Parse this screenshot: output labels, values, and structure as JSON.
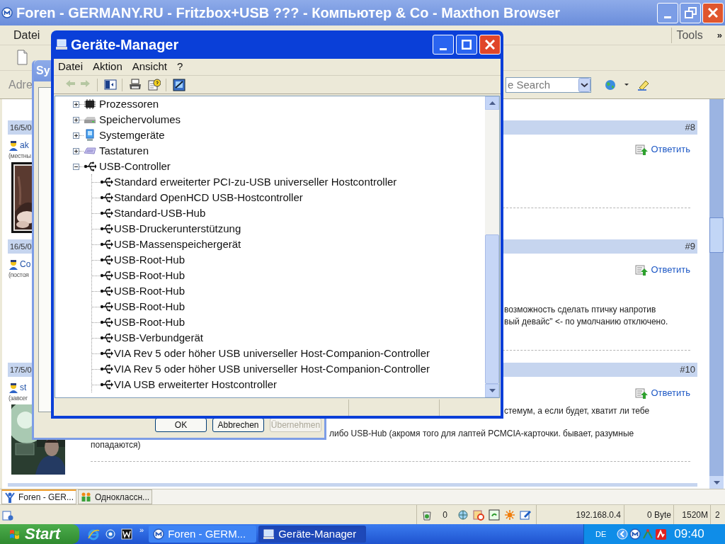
{
  "browser": {
    "title": "Foren - GERMANY.RU - Fritzbox+USB ??? - Компьютер & Co - Maxthon Browser",
    "menu": [
      "Datei",
      "Tools",
      "»"
    ],
    "address_label": "Adre",
    "search": {
      "value": "e Search"
    },
    "posts": [
      {
        "date": "16/5/0",
        "number": "#8",
        "user": "ak",
        "role": "(местны",
        "reply": "Ответить",
        "avatar": {
          "kind": "picture"
        }
      },
      {
        "date": "16/5/0",
        "number": "#9",
        "user": "Co",
        "role": "(постоя",
        "reply": "Ответить",
        "lines": [
          "возможность сделать птичку напротив",
          "вый девайс\" <- по умолчанию отключено."
        ]
      },
      {
        "date": "17/5/0",
        "number": "#10",
        "user": "st",
        "role": "(завсег",
        "reply": "Ответить",
        "avatar": {
          "kind": "picture"
        },
        "lines": [
          "стемум, а если будет, хватит ли тебе"
        ],
        "continuation": [
          "либо USB-Hub (акромя того для лаптей PCMCIA-карточки. бывает, разумные",
          "попадаются)"
        ]
      }
    ],
    "tabs": [
      {
        "label": "Foren - GER...",
        "selected": true
      },
      {
        "label": "Одноклассн...",
        "selected": false
      }
    ],
    "status_bar": {
      "counter": "0",
      "ip": "192.168.0.4",
      "traffic": "0 Byte",
      "memory": "1520M",
      "indicator": "2"
    }
  },
  "dialog": {
    "title": "Sy",
    "buttons": [
      {
        "label": "OK",
        "disabled": false
      },
      {
        "label": "Abbrechen",
        "disabled": false
      },
      {
        "label": "Übernehmen",
        "disabled": true
      }
    ]
  },
  "device_manager": {
    "title": "Geräte-Manager",
    "menu": [
      "Datei",
      "Aktion",
      "Ansicht",
      "?"
    ],
    "toolbar": [
      {
        "kind": "back",
        "disabled": true
      },
      {
        "kind": "forward",
        "disabled": true
      },
      {
        "kind": "panel",
        "disabled": false
      },
      {
        "kind": "print",
        "disabled": false
      },
      {
        "kind": "properties",
        "disabled": false
      },
      {
        "kind": "scan",
        "disabled": false
      }
    ],
    "tree": [
      {
        "kind": "chip",
        "label": "Prozessoren",
        "expanded": false
      },
      {
        "kind": "drive",
        "label": "Speichervolumes",
        "expanded": false
      },
      {
        "kind": "computer",
        "label": "Systemgeräte",
        "expanded": false
      },
      {
        "kind": "keyboard",
        "label": "Tastaturen",
        "expanded": false
      },
      {
        "kind": "usb",
        "label": "USB-Controller",
        "expanded": true,
        "children": [
          {
            "kind": "usb",
            "label": "Standard erweiterter PCI-zu-USB universeller Hostcontroller"
          },
          {
            "kind": "usb",
            "label": "Standard OpenHCD USB-Hostcontroller"
          },
          {
            "kind": "usb",
            "label": "Standard-USB-Hub"
          },
          {
            "kind": "usb",
            "label": "USB-Druckerunterstützung"
          },
          {
            "kind": "usb",
            "label": "USB-Massenspeichergerät"
          },
          {
            "kind": "usb",
            "label": "USB-Root-Hub"
          },
          {
            "kind": "usb",
            "label": "USB-Root-Hub"
          },
          {
            "kind": "usb",
            "label": "USB-Root-Hub"
          },
          {
            "kind": "usb",
            "label": "USB-Root-Hub"
          },
          {
            "kind": "usb",
            "label": "USB-Root-Hub"
          },
          {
            "kind": "usb",
            "label": "USB-Verbundgerät"
          },
          {
            "kind": "usb",
            "label": "VIA Rev 5 oder höher USB universeller Host-Companion-Controller"
          },
          {
            "kind": "usb",
            "label": "VIA Rev 5 oder höher USB universeller Host-Companion-Controller"
          },
          {
            "kind": "usb",
            "label": "VIA USB erweiterter Hostcontroller"
          }
        ]
      }
    ]
  },
  "taskbar": {
    "start": "Start",
    "quick_more": "»",
    "tasks": [
      {
        "label": "Foren - GERM...",
        "selected": false
      },
      {
        "label": "Geräte-Manager",
        "selected": true
      }
    ],
    "language": "DE",
    "clock": "09:40"
  }
}
